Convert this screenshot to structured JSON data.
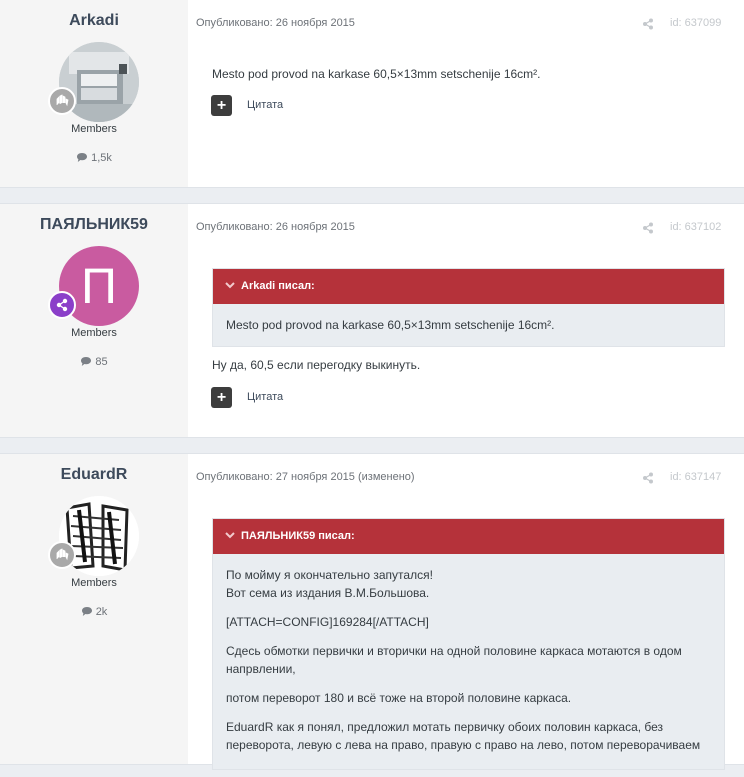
{
  "posts": [
    {
      "author": "Arkadi",
      "group": "Members",
      "count": "1,5k",
      "meta": "Опубликовано: 26 ноября 2015",
      "id": "id: 637099",
      "content": "Mesto pod provod na karkase 60,5×13mm setschenije 16cm².",
      "quote_label": "Цитата"
    },
    {
      "author": "ПАЯЛЬНИК59",
      "avatar_letter": "П",
      "group": "Members",
      "count": "85",
      "meta": "Опубликовано: 26 ноября 2015",
      "id": "id: 637102",
      "quote_header": "Arkadi писал:",
      "quote_text": "Mesto pod provod na karkase 60,5×13mm setschenije 16cm².",
      "content": "Ну да, 60,5 если перегодку выкинуть.",
      "quote_label": "Цитата"
    },
    {
      "author": "EduardR",
      "group": "Members",
      "count": "2k",
      "meta": "Опубликовано: 27 ноября 2015 (изменено)",
      "id": "id: 637147",
      "quote_header": "ПАЯЛЬНИК59 писал:",
      "quote_lines": [
        "По мойму я окончательно запутался!",
        "Вот сема из издания В.М.Большова.",
        "[ATTACH=CONFIG]169284[/ATTACH]",
        "Сдесь обмотки первички и вторички на одной половине каркаса мотаются в одом",
        "напрвлении,",
        "потом переворот 180 и всё тоже на второй половине каркаса.",
        "EduardR как я понял, предложил мотать первичку обоих половин каркаса, без",
        "переворота, левую с лева на право, правую с право на лево, потом переворачиваем"
      ]
    }
  ],
  "colors": {
    "quote_header": "#b5323a",
    "sidebar": "#f5f5f5",
    "avatar2": "#c95ba0",
    "rank2": "#8b3fc9"
  }
}
